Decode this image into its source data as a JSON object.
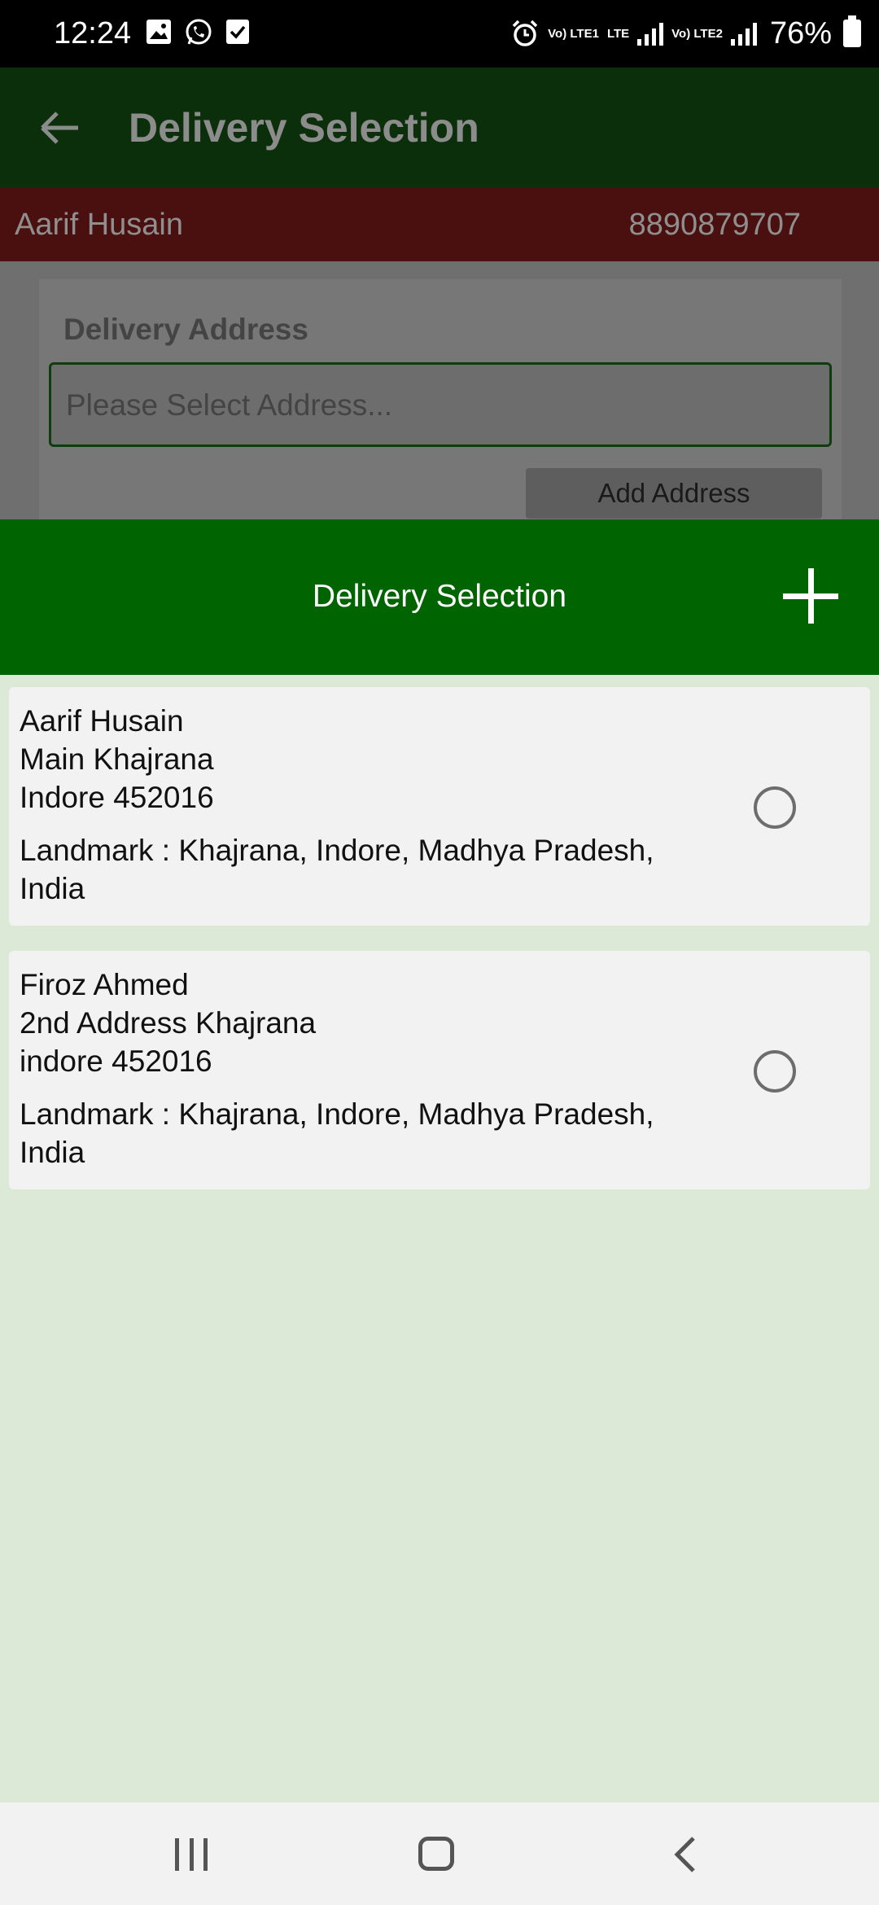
{
  "status_bar": {
    "time": "12:24",
    "network_1": "Vo) LTE1",
    "network_lte": "LTE",
    "network_2": "Vo) LTE2",
    "battery": "76%",
    "icons": [
      "gallery-icon",
      "whatsapp-icon",
      "checkbox-icon",
      "alarm-icon",
      "signal-icon",
      "battery-icon"
    ]
  },
  "app_bar": {
    "title": "Delivery Selection"
  },
  "customer": {
    "name": "Aarif Husain",
    "phone": "8890879707"
  },
  "address_form": {
    "label": "Delivery Address",
    "placeholder": "Please Select Address...",
    "add_button": "Add Address"
  },
  "sheet": {
    "title": "Delivery Selection",
    "addresses": [
      {
        "name": "Aarif Husain",
        "line1": "Main Khajrana",
        "line2": "Indore 452016",
        "landmark": "Landmark : Khajrana, Indore, Madhya Pradesh, India"
      },
      {
        "name": "Firoz Ahmed",
        "line1": "2nd Address Khajrana",
        "line2": "indore 452016",
        "landmark": "Landmark : Khajrana, Indore, Madhya Pradesh, India"
      }
    ]
  },
  "colors": {
    "sheet_header": "#006400",
    "app_bar_dimmed": "#0b2f0b",
    "customer_band_dimmed": "#4a1010",
    "sheet_background": "#dbe9d6"
  }
}
